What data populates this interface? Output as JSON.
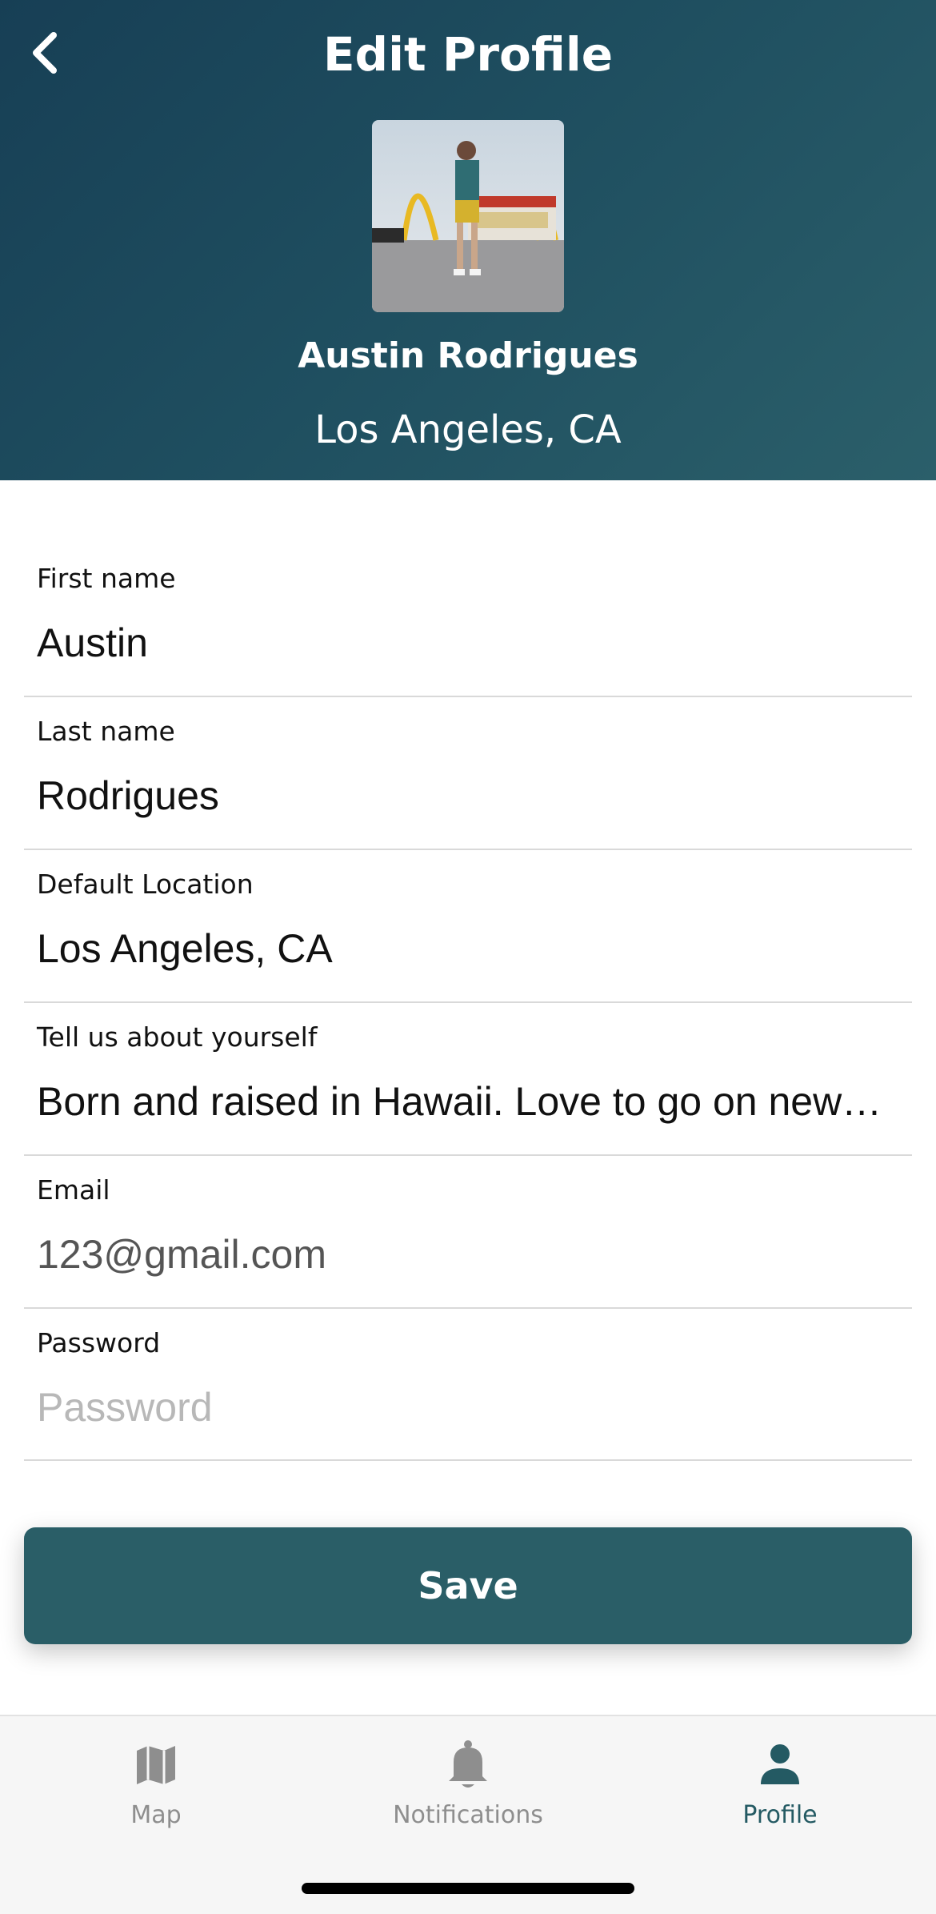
{
  "header": {
    "title": "Edit Profile",
    "back_icon": "chevron-left-icon",
    "profile_name": "Austin Rodrigues",
    "profile_location": "Los Angeles, CA",
    "gradient_colors": [
      "#173f55",
      "#2b5f6a"
    ]
  },
  "form": {
    "first_name": {
      "label": "First name",
      "value": "Austin"
    },
    "last_name": {
      "label": "Last name",
      "value": "Rodrigues"
    },
    "default_location": {
      "label": "Default Location",
      "value": "Los Angeles, CA"
    },
    "about": {
      "label": "Tell us about yourself",
      "value": "Born and raised in Hawaii. Love to go on new…"
    },
    "email": {
      "label": "Email",
      "value": "123@gmail.com"
    },
    "password": {
      "label": "Password",
      "placeholder": "Password"
    }
  },
  "save_button": {
    "label": "Save",
    "color": "#2a5e67"
  },
  "tabbar": {
    "active_color": "#245a63",
    "inactive_color": "#8e8e8e",
    "tabs": [
      {
        "label": "Map",
        "icon": "map-icon",
        "active": false
      },
      {
        "label": "Notifications",
        "icon": "bell-icon",
        "active": false
      },
      {
        "label": "Profile",
        "icon": "person-icon",
        "active": true
      }
    ]
  }
}
